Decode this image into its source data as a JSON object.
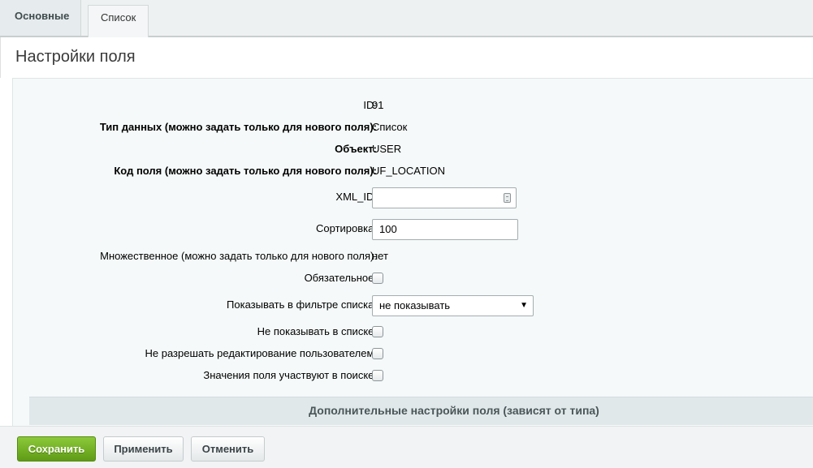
{
  "tabs": [
    {
      "label": "Основные",
      "active": true
    },
    {
      "label": "Список",
      "active": false
    }
  ],
  "heading": {
    "title": "Настройки поля"
  },
  "form": {
    "id": {
      "label": "ID:",
      "value": "91"
    },
    "data_type": {
      "label": "Тип данных (можно задать только для нового поля):",
      "value": "Список"
    },
    "object": {
      "label": "Объект:",
      "value": "USER"
    },
    "field_code": {
      "label": "Код поля (можно задать только для нового поля):",
      "value": "UF_LOCATION"
    },
    "xml_id": {
      "label": "XML_ID:",
      "value": ""
    },
    "sort": {
      "label": "Сортировка:",
      "value": "100"
    },
    "multiple": {
      "label": "Множественное (можно задать только для нового поля):",
      "value": "нет"
    },
    "required": {
      "label": "Обязательное:",
      "checked": false
    },
    "show_filter": {
      "label": "Показывать в фильтре списка:",
      "selected": "не показывать"
    },
    "hide_in_list": {
      "label": "Не показывать в списке:",
      "checked": false
    },
    "no_user_edit": {
      "label": "Не разрешать редактирование пользователем:",
      "checked": false
    },
    "searchable": {
      "label": "Значения поля участвуют в поиске:",
      "checked": false
    }
  },
  "section": {
    "title": "Дополнительные настройки поля (зависят от типа)"
  },
  "buttons": {
    "save": "Сохранить",
    "apply": "Применить",
    "cancel": "Отменить"
  },
  "colors": {
    "save_button": "#6fae22",
    "form_background": "#f5f9f9",
    "section_bar": "#e0e8ea"
  }
}
